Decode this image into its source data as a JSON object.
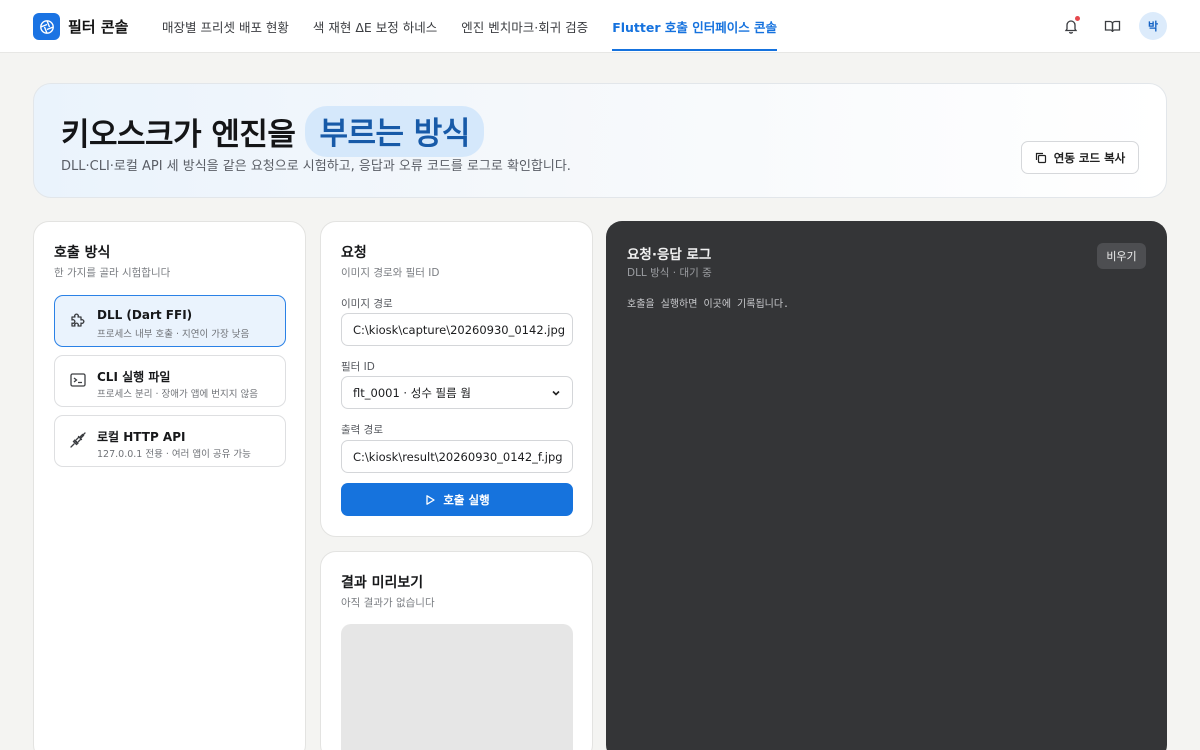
{
  "app": {
    "title": "필터 콘솔"
  },
  "nav": [
    {
      "label": "매장별 프리셋 배포 현황"
    },
    {
      "label": "색 재현 ΔE 보정 하네스"
    },
    {
      "label": "엔진 벤치마크·회귀 검증"
    },
    {
      "label": "Flutter 호출 인터페이스 콘솔",
      "active": true
    }
  ],
  "user": {
    "avatar_initial": "박"
  },
  "hero": {
    "title": "키오스크가 엔진을",
    "highlight": "부르는 방식",
    "subtitle": "DLL·CLI·로컬 API 세 방식을 같은 요청으로 시험하고, 응답과 오류 코드를 로그로 확인합니다.",
    "copy_button": "연동 코드 복사"
  },
  "methods": {
    "title": "호출 방식",
    "subtitle": "한 가지를 골라 시험합니다",
    "items": [
      {
        "title": "DLL (Dart FFI)",
        "desc": "프로세스 내부 호출 · 지연이 가장 낮음",
        "icon": "puzzle-icon",
        "selected": true
      },
      {
        "title": "CLI 실행 파일",
        "desc": "프로세스 분리 · 장애가 앱에 번지지 않음",
        "icon": "terminal-icon",
        "selected": false
      },
      {
        "title": "로컬 HTTP API",
        "desc": "127.0.0.1 전용 · 여러 앱이 공유 가능",
        "icon": "plug-icon",
        "selected": false
      }
    ]
  },
  "request": {
    "title": "요청",
    "subtitle": "이미지 경로와 필터 ID",
    "image_path_label": "이미지 경로",
    "image_path_value": "C:\\kiosk\\capture\\20260930_0142.jpg",
    "filter_id_label": "필터 ID",
    "filter_id_value": "flt_0001 · 성수 필름 웜",
    "output_path_label": "출력 경로",
    "output_path_value": "C:\\kiosk\\result\\20260930_0142_f.jpg",
    "run_button": "호출 실행"
  },
  "preview": {
    "title": "결과 미리보기",
    "subtitle": "아직 결과가 없습니다"
  },
  "log": {
    "title": "요청·응답 로그",
    "subtitle": "DLL 방식 · 대기 중",
    "clear_button": "비우기",
    "placeholder": "호출을 실행하면 이곳에 기록됩니다."
  },
  "colors": {
    "accent": "#1673dd",
    "log_bg": "#343537",
    "selected_bg": "#eaf3fd"
  }
}
